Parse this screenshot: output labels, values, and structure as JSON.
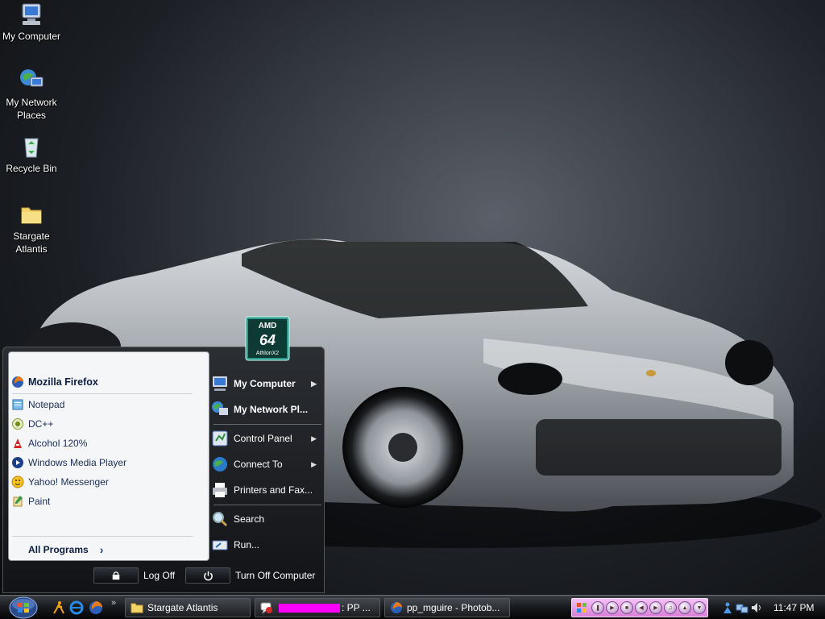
{
  "desktop": {
    "icons": [
      {
        "label": "My Computer"
      },
      {
        "label": "My Network Places"
      },
      {
        "label": "Recycle Bin"
      },
      {
        "label": "Stargate Atlantis"
      }
    ]
  },
  "start_menu": {
    "badge": {
      "brand": "AMD",
      "number": "64",
      "model": "AthlonX2"
    },
    "pinned": [
      {
        "label": "Mozilla Firefox",
        "icon": "firefox-icon"
      }
    ],
    "recent": [
      {
        "label": "Notepad",
        "icon": "notepad-icon"
      },
      {
        "label": "DC++",
        "icon": "dcpp-icon"
      },
      {
        "label": "Alcohol 120%",
        "icon": "alcohol-icon"
      },
      {
        "label": "Windows Media Player",
        "icon": "media-player-icon"
      },
      {
        "label": "Yahoo! Messenger",
        "icon": "yahoo-messenger-icon"
      },
      {
        "label": "Paint",
        "icon": "paint-icon"
      }
    ],
    "all_programs": "All Programs",
    "right": {
      "my_computer": "My Computer",
      "my_network": "My Network Pl...",
      "control_panel": "Control Panel",
      "connect_to": "Connect To",
      "printers": "Printers and Fax...",
      "search": "Search",
      "run": "Run..."
    },
    "log_off": "Log Off",
    "turn_off": "Turn Off Computer"
  },
  "taskbar": {
    "show_more": "»",
    "tasks": [
      {
        "label": "Stargate Atlantis"
      },
      {
        "prefix": "",
        "suffix": ": PP ..."
      },
      {
        "label": "pp_mguire - Photob..."
      }
    ],
    "clock": "11:47 PM"
  },
  "colors": {
    "redaction": "#ff00ff",
    "media_bar": "#e59ae5"
  }
}
